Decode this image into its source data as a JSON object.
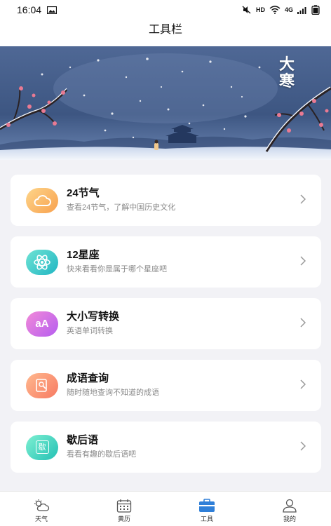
{
  "status_bar": {
    "time": "16:04",
    "hd_label": "HD",
    "network_label": "4G"
  },
  "header": {
    "title": "工具栏"
  },
  "banner": {
    "caption": "大寒"
  },
  "tools": [
    {
      "title": "24节气",
      "subtitle": "查看24节气，了解中国历史文化",
      "icon": "cloud-icon",
      "color_from": "#fdd58a",
      "color_to": "#f8a14e"
    },
    {
      "title": "12星座",
      "subtitle": "快来看看你是属于哪个星座吧",
      "icon": "atom-icon",
      "color_from": "#6fe3d4",
      "color_to": "#21b6c3"
    },
    {
      "title": "大小写转换",
      "subtitle": "英语单词转换",
      "icon": "case-convert-icon",
      "glyph": "aA",
      "color_from": "#f28ad8",
      "color_to": "#b55df0"
    },
    {
      "title": "成语查询",
      "subtitle": "随时随地查询不知道的成语",
      "icon": "idiom-search-icon",
      "color_from": "#ffb98f",
      "color_to": "#f77a62"
    },
    {
      "title": "歇后语",
      "subtitle": "看看有趣的歇后语吧",
      "icon": "book-icon",
      "glyph": "歇",
      "color_from": "#7ff0d2",
      "color_to": "#23c0b4"
    }
  ],
  "tabs": [
    {
      "label": "天气",
      "icon": "weather-icon",
      "active": false
    },
    {
      "label": "黄历",
      "icon": "calendar-icon",
      "active": false
    },
    {
      "label": "工具",
      "icon": "toolbox-icon",
      "active": true
    },
    {
      "label": "我的",
      "icon": "profile-icon",
      "active": false
    }
  ],
  "colors": {
    "accent": "#2f7fd8",
    "background": "#f2f2f6",
    "text_secondary": "#8a8a8a"
  }
}
